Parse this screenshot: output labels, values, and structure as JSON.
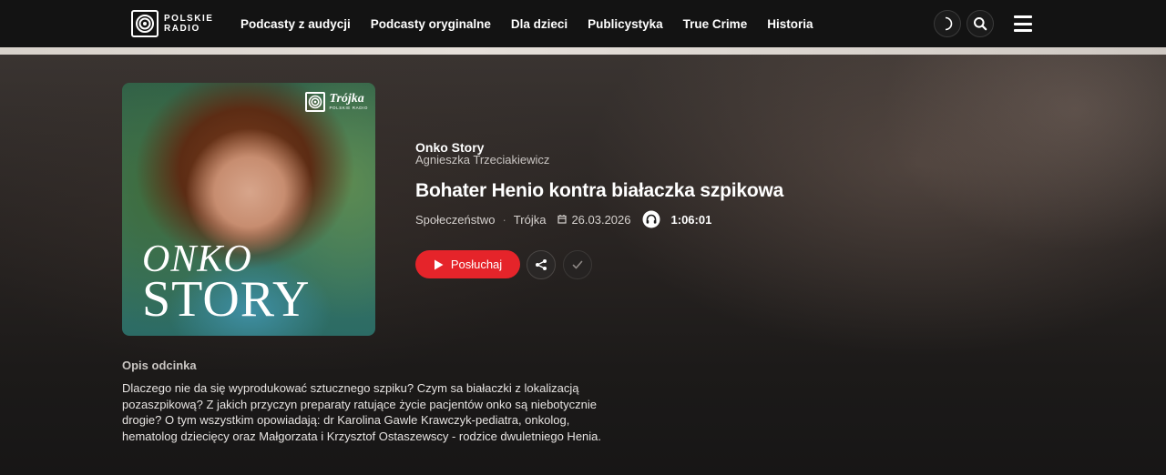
{
  "brand": {
    "line1": "POLSKIE",
    "line2": "RADIO"
  },
  "nav": {
    "items": [
      "Podcasty z audycji",
      "Podcasty oryginalne",
      "Dla dzieci",
      "Publicystyka",
      "True Crime",
      "Historia"
    ]
  },
  "cover": {
    "badge_brand": "Trójka",
    "badge_sub": "POLSKIE RADIO",
    "title_line1": "ONKO",
    "title_line2": "STORY"
  },
  "episode": {
    "show": "Onko Story",
    "author": "Agnieszka Trzeciakiewicz",
    "title": "Bohater Henio kontra białaczka szpikowa",
    "category": "Społeczeństwo",
    "separator": "·",
    "station": "Trójka",
    "date": "26.03.2026",
    "duration": "1:06:01"
  },
  "actions": {
    "listen_label": "Posłuchaj"
  },
  "description": {
    "label": "Opis odcinka",
    "text": "Dlaczego nie da się wyprodukować sztucznego szpiku? Czym sa białaczki z lokalizacją pozaszpikową? Z jakich przyczyn preparaty ratujące życie pacjentów onko są niebotycznie drogie? O tym wszystkim opowiadają: dr Karolina Gawle Krawczyk-pediatra, onkolog, hematolog dziecięcy oraz Małgorzata i Krzysztof Ostaszewscy - rodzice dwuletniego Henia."
  },
  "colors": {
    "accent": "#e5242a",
    "background": "#181717",
    "topbar": "#131313"
  },
  "icons": [
    "theme-toggle-icon",
    "search-icon",
    "menu-icon",
    "play-icon",
    "share-icon",
    "check-icon",
    "calendar-icon",
    "headphones-icon"
  ]
}
